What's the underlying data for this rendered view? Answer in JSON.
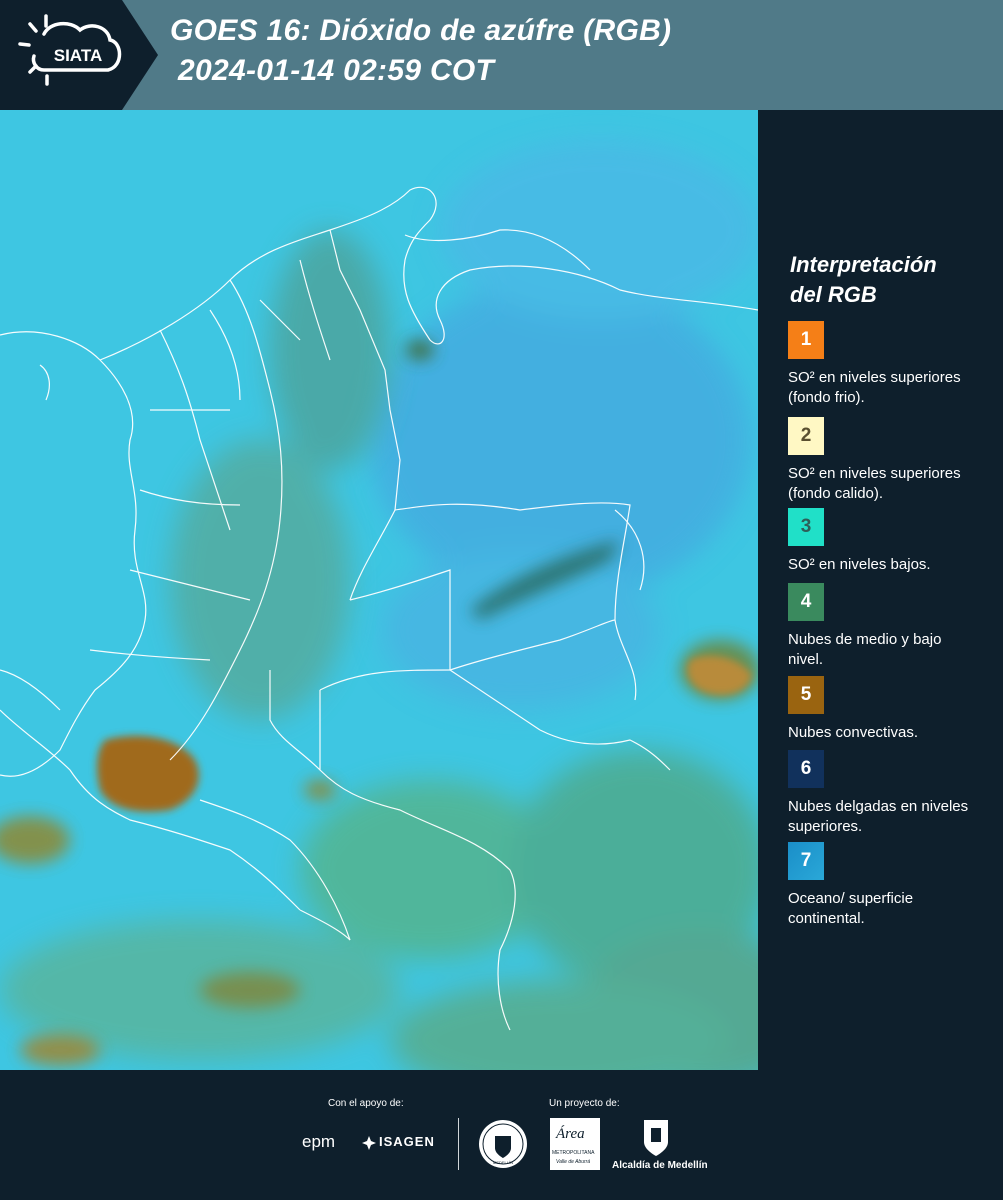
{
  "header": {
    "logo_text": "SIATA",
    "title_line1": "GOES 16: Dióxido de azúfre (RGB)",
    "title_line2": "2024-01-14 02:59 COT"
  },
  "colors": {
    "header_bg": "#507a88",
    "dark_bg": "#0e1f2c",
    "map_base": "#3ec6e2",
    "border_lines": "#ffffff"
  },
  "legend": {
    "title_line1": "Interpretación",
    "title_line2": "del RGB",
    "items": [
      {
        "number": "1",
        "color": "#f57f17",
        "text": "SO² en niveles superiores (fondo frio)."
      },
      {
        "number": "2",
        "color": "#fff8c4",
        "text": "SO² en niveles superiores (fondo calido)."
      },
      {
        "number": "3",
        "color": "#20e0c8",
        "text": "SO² en niveles bajos."
      },
      {
        "number": "4",
        "color": "#3a8a5e",
        "text": "Nubes de medio y bajo nivel."
      },
      {
        "number": "5",
        "color": "#9a6410",
        "text": "Nubes convectivas."
      },
      {
        "number": "6",
        "color": "#11315c",
        "text": "Nubes delgadas en niveles superiores."
      },
      {
        "number": "7",
        "color": "#1a8ec8",
        "text": "Oceano/ superficie continental."
      }
    ]
  },
  "footer": {
    "support_label": "Con el apoyo de:",
    "project_label": "Un proyecto de:",
    "sponsor_epm": "epm",
    "sponsor_isagen": "ISAGEN",
    "partner_area_line1": "Área",
    "partner_area_line2": "METROPOLITANA",
    "partner_area_line3": "Valle de Aburrá",
    "partner_alcaldia": "Alcaldía de Medellín",
    "seal_text": "MEDELLÍN"
  }
}
